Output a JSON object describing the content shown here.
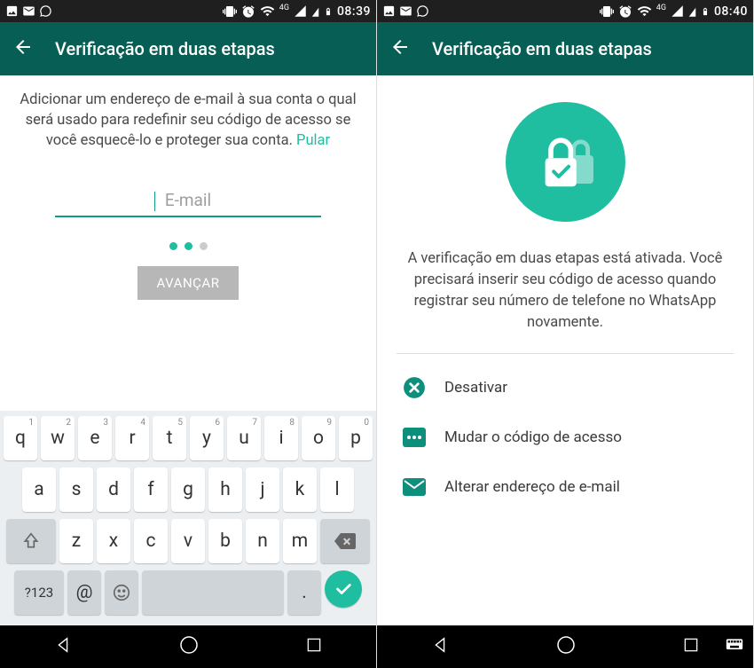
{
  "left": {
    "status": {
      "time": "08:39",
      "net": "4G"
    },
    "title": "Verificação em duas etapas",
    "description": "Adicionar um endereço de e-mail à sua conta o qual será usado para redefinir seu código de acesso se você esquecê-lo e proteger sua conta. ",
    "skip": "Pular",
    "email_placeholder": "E-mail",
    "button": "AVANÇAR",
    "keyboard": {
      "row1": [
        "q",
        "w",
        "e",
        "r",
        "t",
        "y",
        "u",
        "i",
        "o",
        "p"
      ],
      "nums": [
        "1",
        "2",
        "3",
        "4",
        "5",
        "6",
        "7",
        "8",
        "9",
        "0"
      ],
      "row2": [
        "a",
        "s",
        "d",
        "f",
        "g",
        "h",
        "j",
        "k",
        "l"
      ],
      "row3": [
        "z",
        "x",
        "c",
        "v",
        "b",
        "n",
        "m"
      ],
      "sym": "?123",
      "at": "@",
      "period": "."
    }
  },
  "right": {
    "status": {
      "time": "08:40",
      "net": "4G"
    },
    "title": "Verificação em duas etapas",
    "description": "A verificação em duas etapas está ativada. Você precisará inserir seu código de acesso quando registrar seu número de telefone no WhatsApp novamente.",
    "options": {
      "disable": "Desativar",
      "change_code": "Mudar o código de acesso",
      "change_email": "Alterar endereço de e-mail"
    }
  }
}
